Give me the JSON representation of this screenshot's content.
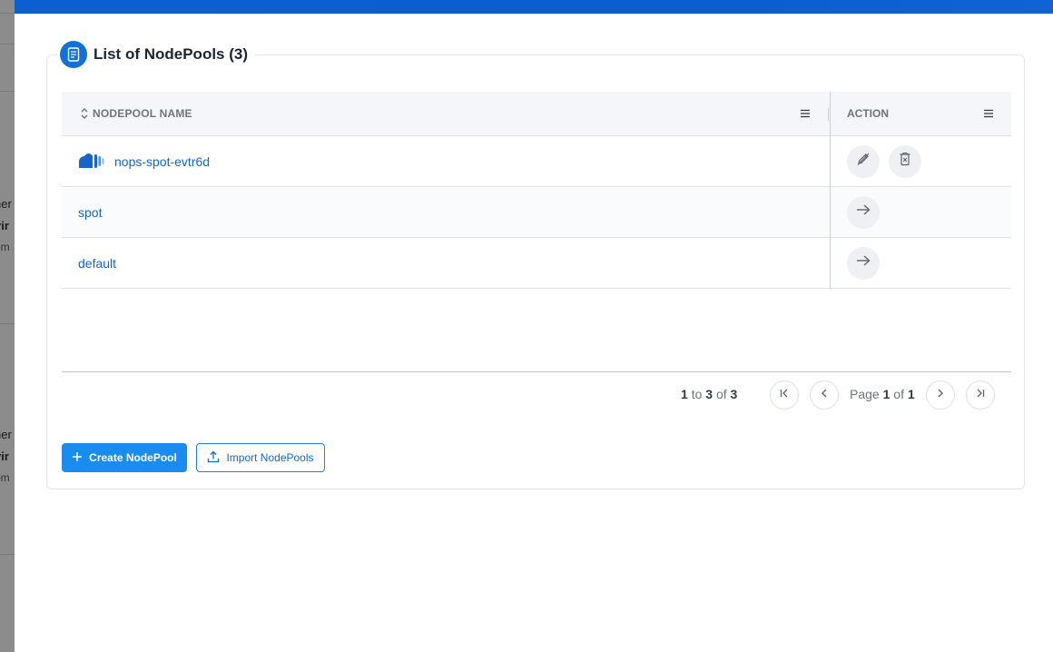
{
  "background": {
    "fragments": [
      "ner",
      "vir",
      "om",
      "ner",
      "vir",
      "om"
    ]
  },
  "panel": {
    "title": "List of NodePools (3)"
  },
  "table": {
    "columns": {
      "name": "NODEPOOL NAME",
      "action": "ACTION"
    },
    "rows": [
      {
        "name": "nops-spot-evtr6d",
        "logo": "nops-logo-icon",
        "actions": [
          "edit-icon",
          "delete-icon"
        ]
      },
      {
        "name": "spot",
        "actions": [
          "arrow-right-icon"
        ]
      },
      {
        "name": "default",
        "actions": [
          "arrow-right-icon"
        ]
      }
    ]
  },
  "pagination": {
    "from": "1",
    "to_word": "to",
    "to": "3",
    "of_word": "of",
    "total": "3",
    "page_word": "Page",
    "page": "1",
    "page_of_word": "of",
    "pages": "1"
  },
  "buttons": {
    "create": "Create NodePool",
    "import": "Import NodePools"
  },
  "colors": {
    "accent": "#1a8cf0",
    "topbar": "#0b60d1",
    "link": "#1565c8"
  }
}
